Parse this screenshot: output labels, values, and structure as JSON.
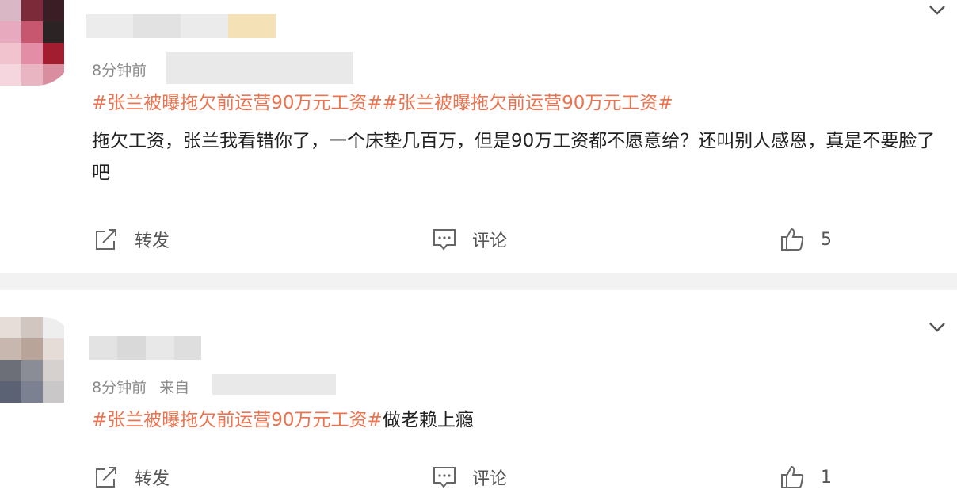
{
  "posts": [
    {
      "time": "8分钟前",
      "source_label": "",
      "tag_text": "#张兰被曝拖欠前运营90万元工资##张兰被曝拖欠前运营90万元工资#",
      "body_text": "拖欠工资，张兰我看错你了，一个床垫几百万，但是90万工资都不愿意给？还叫别人感恩，真是不要脸了吧",
      "actions": {
        "repost": "转发",
        "comment": "评论",
        "like_count": "5"
      }
    },
    {
      "time": "8分钟前",
      "source_label": "来自",
      "tag_text": "#张兰被曝拖欠前运营90万元工资#",
      "body_text": "做老赖上瘾",
      "actions": {
        "repost": "转发",
        "comment": "评论",
        "like_count": "1"
      }
    }
  ],
  "colors": {
    "tag": "#eb7350",
    "divider": "#f2f2f2",
    "meta": "#8a8a8a"
  },
  "icons": [
    "chevron-down-icon",
    "repost-icon",
    "comment-icon",
    "like-icon"
  ]
}
